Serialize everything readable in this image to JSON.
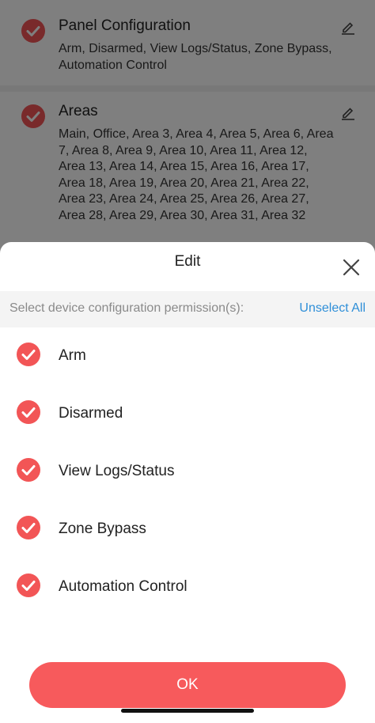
{
  "background": {
    "cards": [
      {
        "title": "Panel Configuration",
        "description": "Arm, Disarmed, View Logs/Status, Zone Bypass, Automation Control"
      },
      {
        "title": "Areas",
        "description": "Main, Office, Area 3, Area 4, Area 5, Area 6, Area 7, Area 8, Area 9, Area 10, Area 11, Area 12, Area 13, Area 14, Area 15, Area 16, Area 17, Area 18, Area 19, Area 20, Area 21, Area 22, Area 23, Area 24, Area 25, Area 26, Area 27, Area 28, Area 29, Area 30, Area 31, Area 32"
      }
    ]
  },
  "sheet": {
    "title": "Edit",
    "subheader_label": "Select device configuration permission(s):",
    "unselect_all_label": "Unselect All",
    "options": [
      {
        "label": "Arm",
        "checked": true
      },
      {
        "label": "Disarmed",
        "checked": true
      },
      {
        "label": "View Logs/Status",
        "checked": true
      },
      {
        "label": "Zone Bypass",
        "checked": true
      },
      {
        "label": "Automation Control",
        "checked": true
      }
    ],
    "ok_label": "OK"
  },
  "colors": {
    "check_red": "#f25556",
    "ok_red": "#f75a5c",
    "link_blue": "#2f8fd8"
  },
  "icons": {
    "check": "check-circle-icon",
    "edit": "pencil-icon",
    "close": "close-icon"
  }
}
